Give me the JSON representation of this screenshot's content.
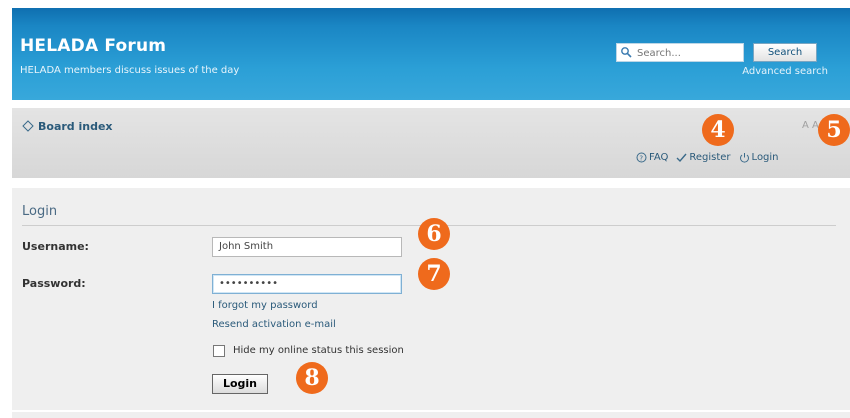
{
  "header": {
    "title": "HELADA Forum",
    "description": "HELADA members discuss issues of the day",
    "search_placeholder": "Search...",
    "search_button": "Search",
    "advanced_search": "Advanced search"
  },
  "navbar": {
    "board_index": "Board index",
    "font_resize": "A A",
    "links": {
      "faq": "FAQ",
      "register": "Register",
      "login": "Login"
    }
  },
  "login_form": {
    "title": "Login",
    "username_label": "Username:",
    "username_value": "John Smith",
    "password_label": "Password:",
    "password_value": "••••••••••",
    "forgot_link": "I forgot my password",
    "resend_link": "Resend activation e-mail",
    "hide_status_label": "Hide my online status this session",
    "hide_status_checked": false,
    "login_button": "Login"
  },
  "annotations": {
    "marker_4": "4",
    "marker_5": "5",
    "marker_6": "6",
    "marker_7": "7",
    "marker_8": "8",
    "color": "#ef6a1c"
  }
}
